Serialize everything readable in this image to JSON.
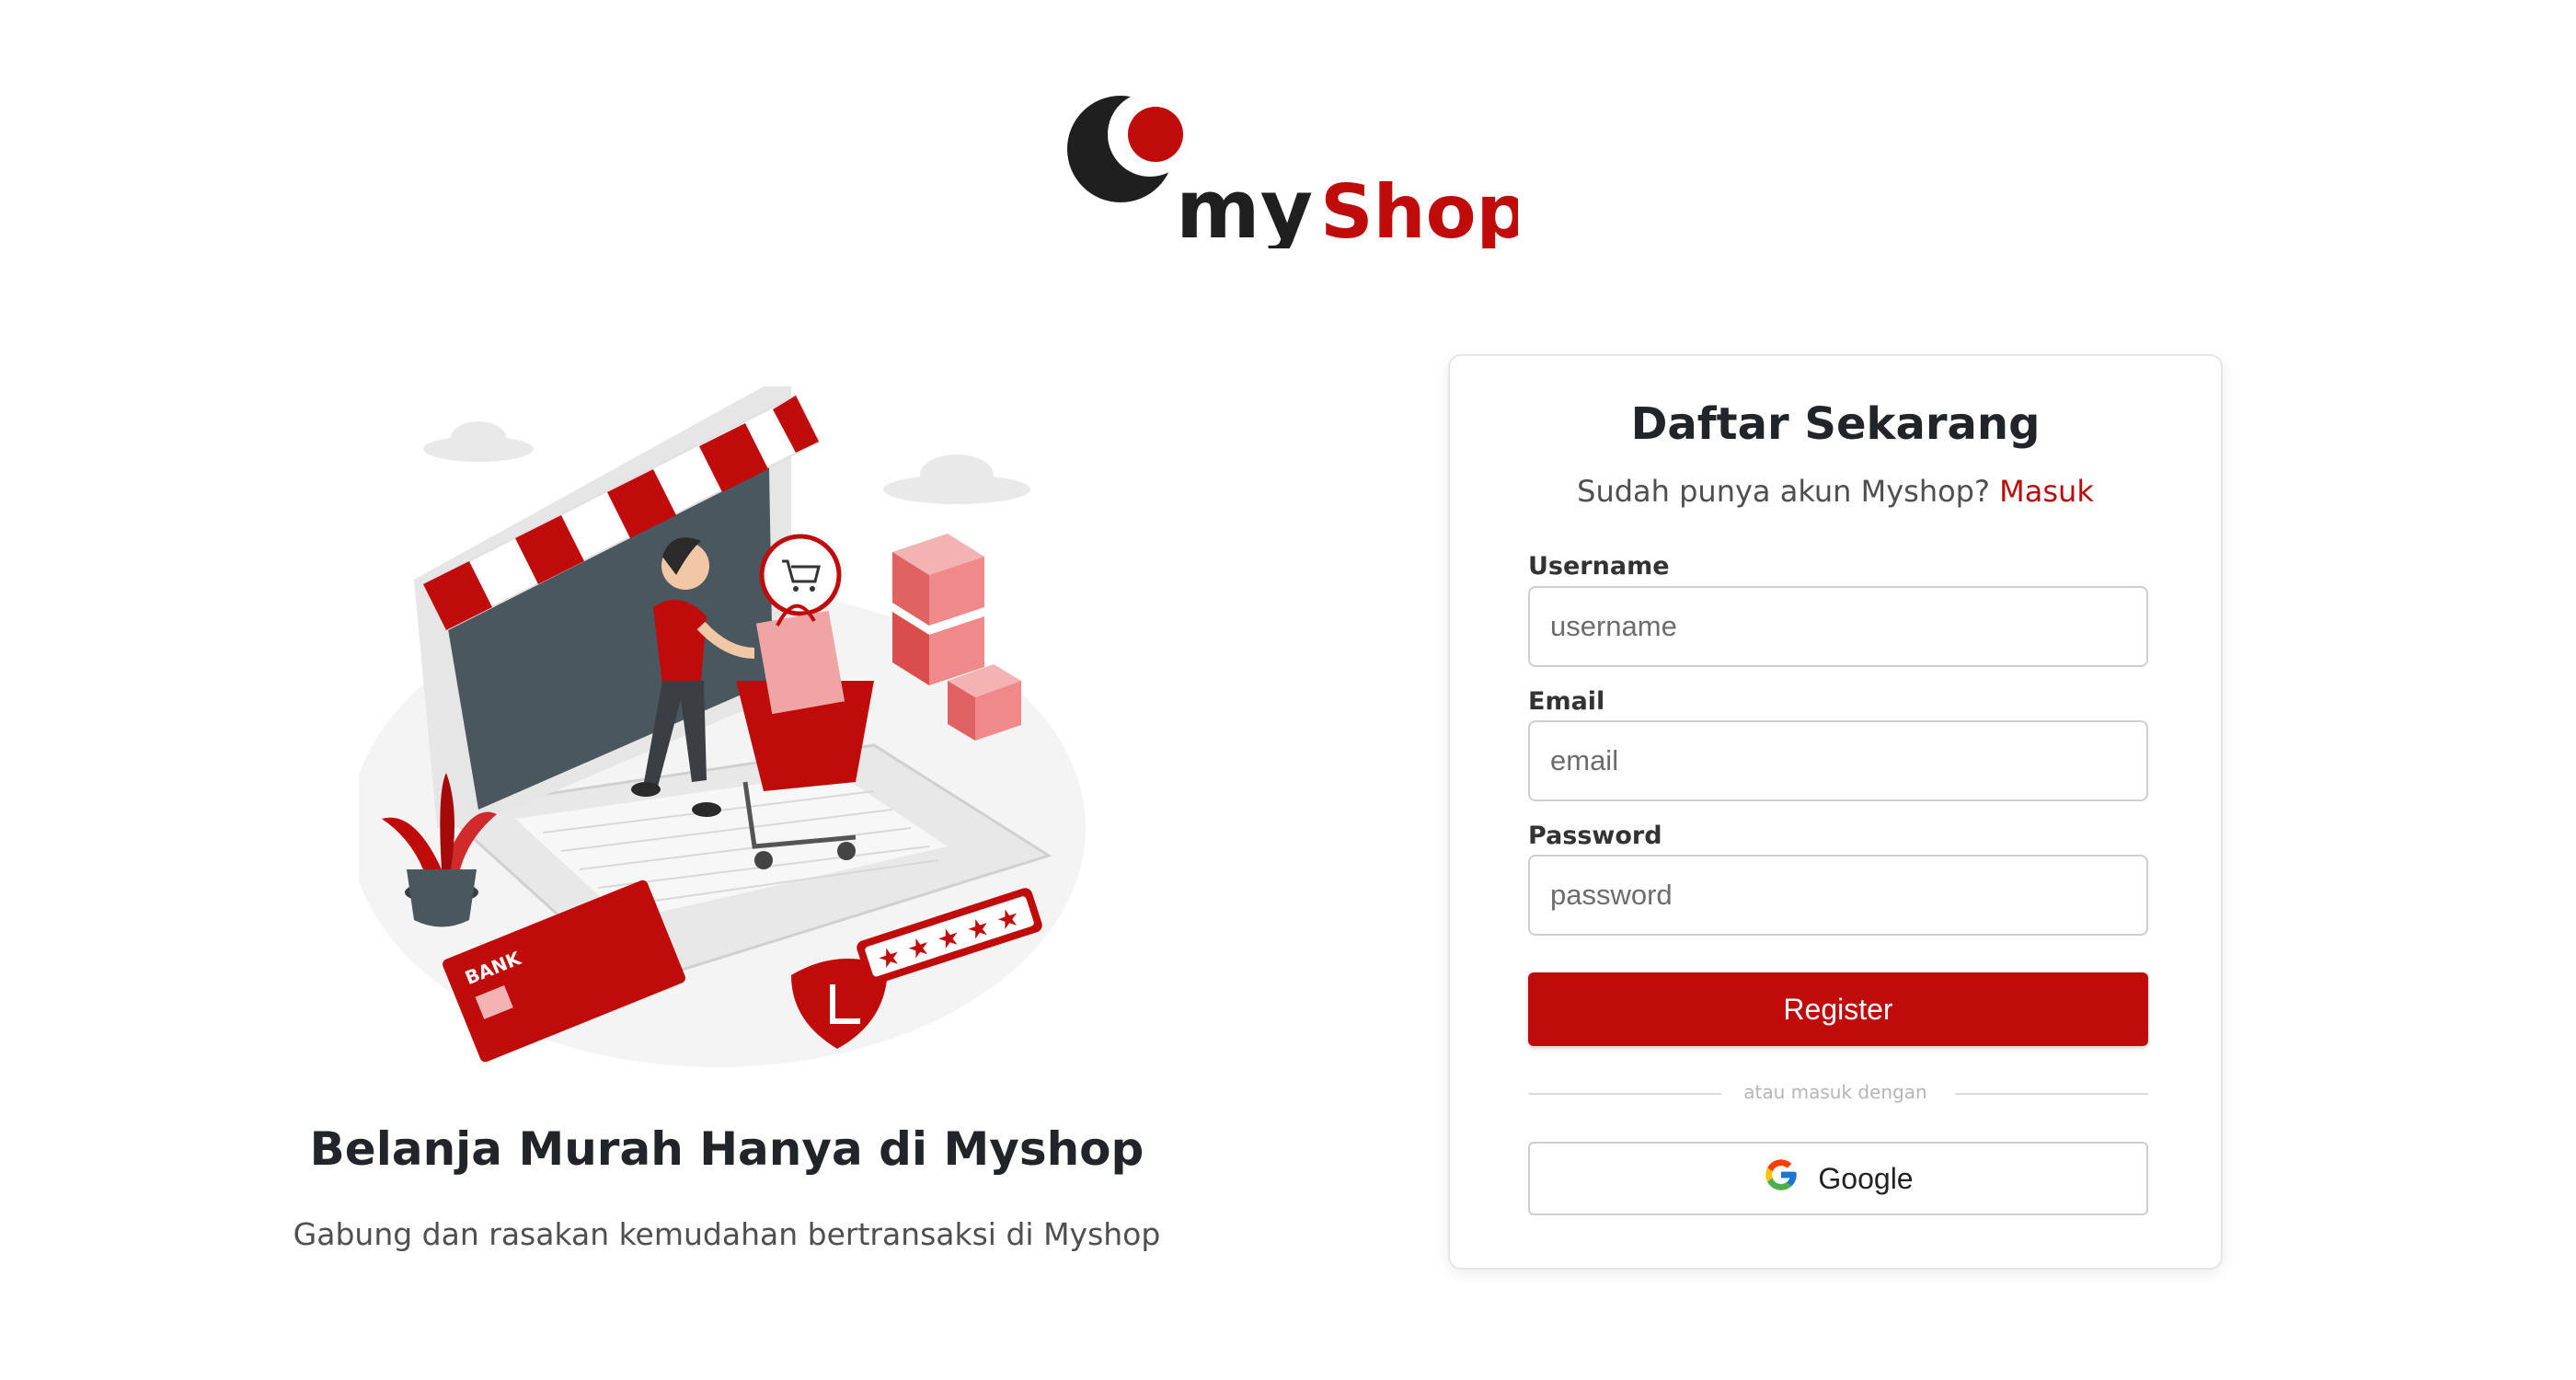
{
  "logo": {
    "word1": "my",
    "word2": "Shop"
  },
  "hero": {
    "title": "Belanja Murah Hanya di Myshop",
    "subtitle": "Gabung dan rasakan kemudahan bertransaksi di Myshop"
  },
  "illustration": {
    "card_text": "BANK",
    "stars": 5
  },
  "form": {
    "title": "Daftar Sekarang",
    "prompt": "Sudah punya akun Myshop?",
    "login_link": "Masuk",
    "username": {
      "label": "Username",
      "placeholder": "username",
      "value": ""
    },
    "email": {
      "label": "Email",
      "placeholder": "email",
      "value": ""
    },
    "password": {
      "label": "Password",
      "placeholder": "password",
      "value": ""
    },
    "register_label": "Register",
    "divider_text": "atau masuk dengan",
    "google_label": "Google",
    "google_icon": "google-icon"
  },
  "colors": {
    "brand_red": "#c00b0b",
    "brand_dark": "#1f1f1f"
  }
}
